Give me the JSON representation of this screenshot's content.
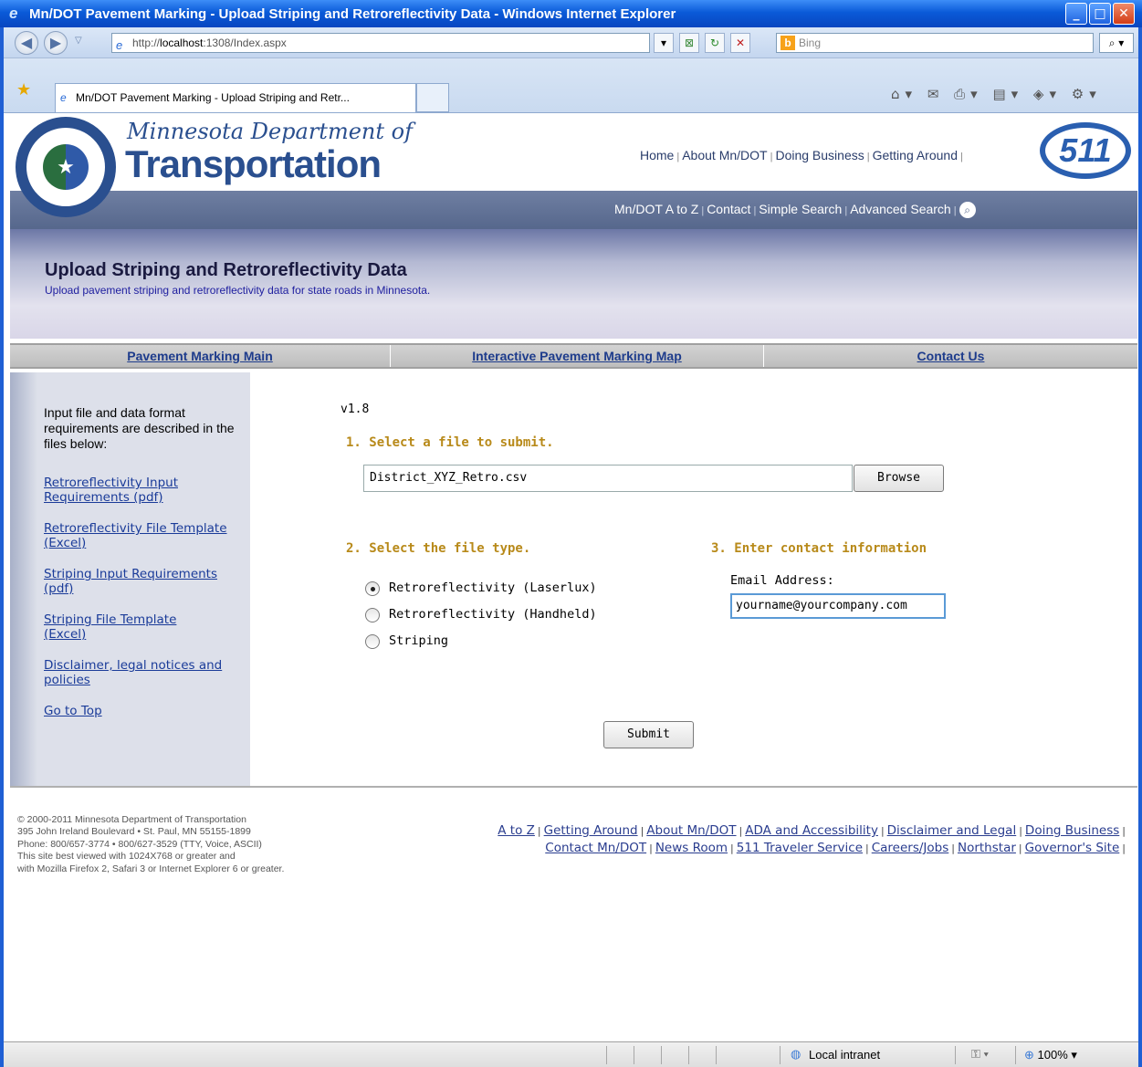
{
  "window": {
    "title": "Mn/DOT Pavement Marking - Upload Striping and Retroreflectivity Data - Windows Internet Explorer"
  },
  "browser": {
    "url_prefix": "http://",
    "url_host": "localhost",
    "url_rest": ":1308/Index.aspx",
    "search_placeholder": "Bing",
    "tab_title": "Mn/DOT Pavement Marking - Upload Striping and Retr..."
  },
  "header": {
    "org_script": "Minnesota Department of",
    "org_main": "Transportation",
    "top_links": [
      "Home",
      "About Mn/DOT",
      "Doing Business",
      "Getting Around"
    ],
    "badge": "511",
    "sub_links": [
      "Mn/DOT A to Z",
      "Contact",
      "Simple Search",
      "Advanced Search"
    ]
  },
  "banner": {
    "title": "Upload Striping and Retroreflectivity Data",
    "subtitle": "Upload pavement striping and retroreflectivity data for state roads in Minnesota."
  },
  "nav": {
    "items": [
      "Pavement Marking Main",
      "Interactive Pavement Marking Map",
      "Contact Us"
    ]
  },
  "sidebar": {
    "intro": "Input file and data format requirements are described in the files below:",
    "links": [
      "Retroreflectivity Input Requirements (pdf)",
      "Retroreflectivity File Template (Excel)",
      "Striping Input Requirements (pdf)",
      "Striping File Template (Excel)",
      "Disclaimer, legal notices and policies",
      "Go to Top"
    ]
  },
  "form": {
    "version": "v1.8",
    "step1": "1. Select a file to submit.",
    "file_value": "District_XYZ_Retro.csv",
    "browse_label": "Browse",
    "step2": "2. Select the file type.",
    "file_types": [
      "Retroreflectivity (Laserlux)",
      "Retroreflectivity (Handheld)",
      "Striping"
    ],
    "selected_type": "Retroreflectivity (Laserlux)",
    "step3": "3. Enter contact information",
    "email_label": "Email Address:",
    "email_value": "yourname@yourcompany.com",
    "submit_label": "Submit"
  },
  "footer": {
    "copyright_lines": [
      "© 2000-2011 Minnesota Department of Transportation",
      "395 John Ireland Boulevard • St. Paul, MN 55155-1899",
      "Phone: 800/657-3774 • 800/627-3529 (TTY, Voice, ASCII)",
      "This site best viewed with 1024X768 or greater and",
      "with Mozilla Firefox 2, Safari 3 or Internet Explorer 6 or greater."
    ],
    "links_row1": [
      "A to Z",
      "Getting Around",
      "About Mn/DOT",
      "ADA and Accessibility",
      "Disclaimer and Legal",
      "Doing Business"
    ],
    "links_row2": [
      "Contact Mn/DOT",
      "News Room",
      "511 Traveler Service",
      "Careers/Jobs",
      "Northstar",
      "Governor's Site"
    ]
  },
  "status": {
    "zone": "Local intranet",
    "zoom": "100%"
  }
}
